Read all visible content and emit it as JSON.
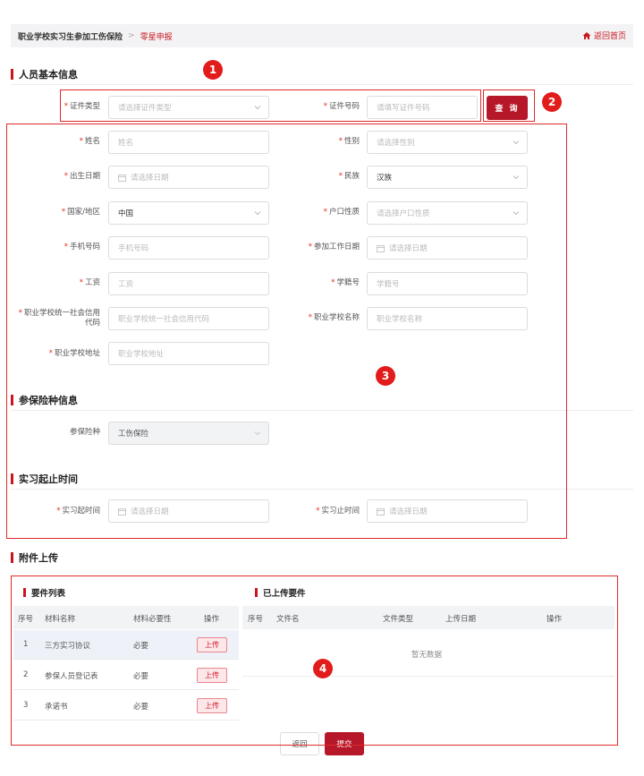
{
  "breadcrumb": {
    "level1": "职业学校实习生参加工伤保险",
    "separator": ">",
    "level2": "零星申报"
  },
  "home_link": "返回首页",
  "sections": {
    "basic": "人员基本信息",
    "insurance": "参保险种信息",
    "period": "实习起止时间",
    "attachment": "附件上传"
  },
  "query": {
    "id_type": {
      "label": "证件类型",
      "placeholder": "请选择证件类型"
    },
    "id_number": {
      "label": "证件号码",
      "placeholder": "请填写证件号码"
    },
    "button": "查 询"
  },
  "form": {
    "name": {
      "label": "姓名",
      "placeholder": "姓名"
    },
    "gender": {
      "label": "性别",
      "placeholder": "请选择性别"
    },
    "birth": {
      "label": "出生日期",
      "placeholder": "请选择日期"
    },
    "ethnicity": {
      "label": "民族",
      "value": "汉族"
    },
    "country": {
      "label": "国家/地区",
      "value": "中国"
    },
    "hukou": {
      "label": "户口性质",
      "placeholder": "请选择户口性质"
    },
    "phone": {
      "label": "手机号码",
      "placeholder": "手机号码"
    },
    "work_date": {
      "label": "参加工作日期",
      "placeholder": "请选择日期"
    },
    "salary": {
      "label": "工资",
      "placeholder": "工资"
    },
    "student_no": {
      "label": "学籍号",
      "placeholder": "学籍号"
    },
    "credit_code": {
      "label_line1": "职业学校统一社会信用",
      "label_line2": "代码",
      "placeholder": "职业学校统一社会信用代码"
    },
    "school_name": {
      "label": "职业学校名称",
      "placeholder": "职业学校名称"
    },
    "school_addr": {
      "label": "职业学校地址",
      "placeholder": "职业学校地址"
    }
  },
  "insurance": {
    "label": "参保险种",
    "value": "工伤保险"
  },
  "period": {
    "start": {
      "label": "实习起时间",
      "placeholder": "请选择日期"
    },
    "end": {
      "label": "实习止时间",
      "placeholder": "请选择日期"
    }
  },
  "required_list": {
    "title": "要件列表",
    "headers": [
      "序号",
      "材料名称",
      "材料必要性",
      "操作"
    ],
    "rows": [
      {
        "no": "1",
        "name": "三方实习协议",
        "necessity": "必要",
        "action": "上传"
      },
      {
        "no": "2",
        "name": "参保人员登记表",
        "necessity": "必要",
        "action": "上传"
      },
      {
        "no": "3",
        "name": "承诺书",
        "necessity": "必要",
        "action": "上传"
      }
    ]
  },
  "uploaded_list": {
    "title": "已上传要件",
    "headers": [
      "序号",
      "文件名",
      "文件类型",
      "上传日期",
      "操作"
    ],
    "empty_text": "暂无数据"
  },
  "buttons": {
    "back": "返回",
    "submit": "提交"
  },
  "badges": [
    "1",
    "2",
    "3",
    "4"
  ],
  "colors": {
    "accent": "#c8161e",
    "primary_button": "#b6182a",
    "annotation": "#e21b1b"
  }
}
